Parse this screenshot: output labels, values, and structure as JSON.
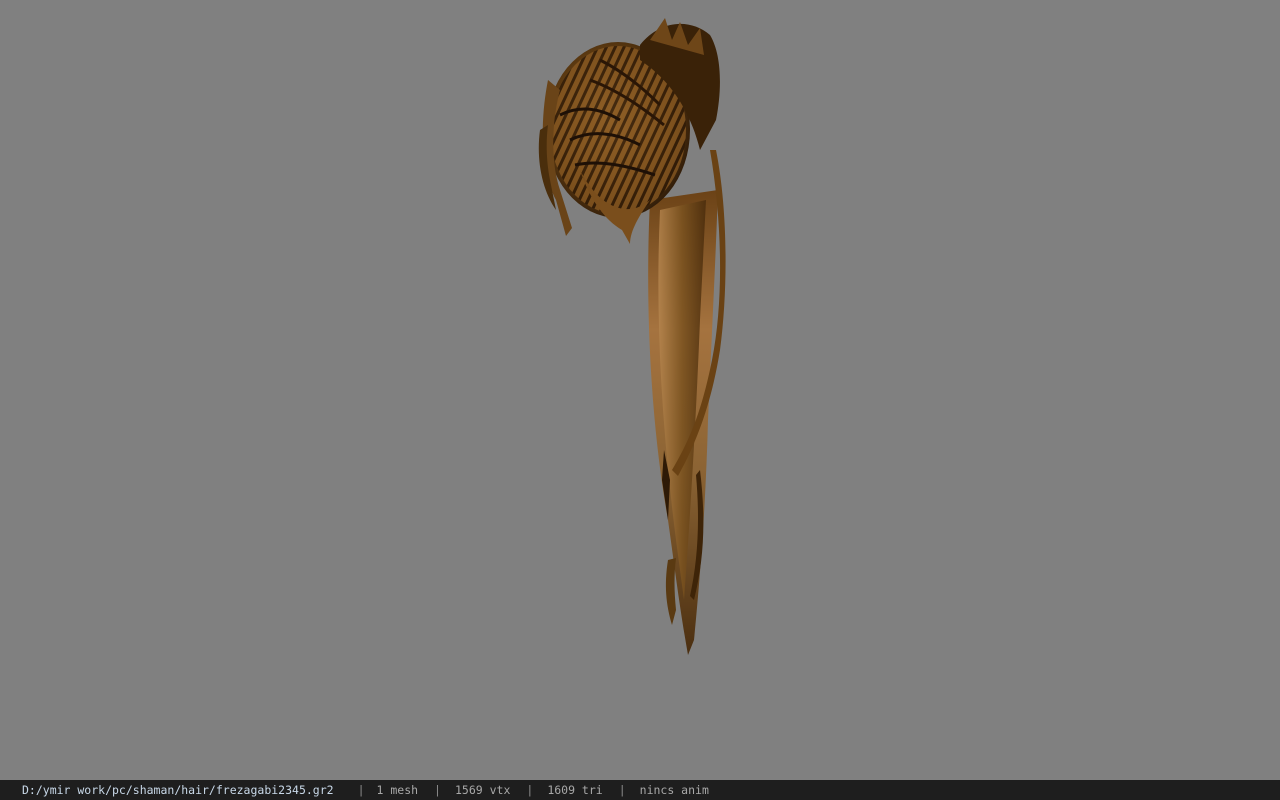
{
  "viewer": {
    "background_color": "#808080",
    "model_icon": "hair-mesh-model"
  },
  "statusbar": {
    "file_path": "D:/ymir work/pc/shaman/hair/frezagabi2345.gr2",
    "mesh_count": "1 mesh",
    "vertex_count": "1569 vtx",
    "triangle_count": "1609 tri",
    "animation": "nincs anim",
    "separator": "|"
  }
}
